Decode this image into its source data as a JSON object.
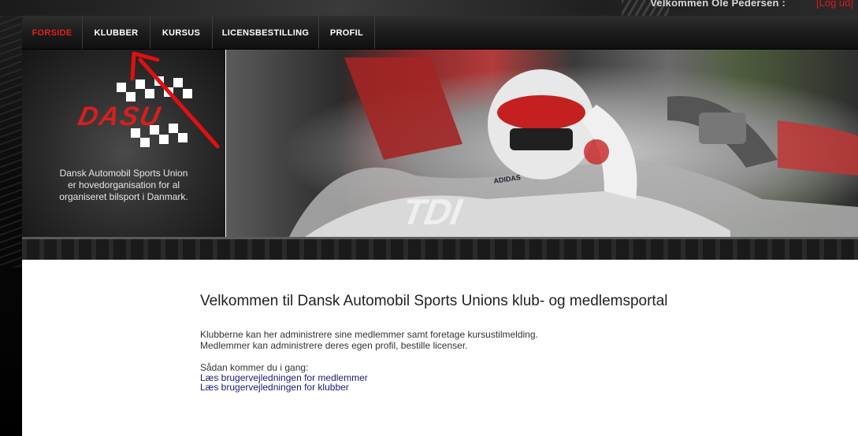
{
  "header": {
    "welcome_text": "Velkommen Ole Pedersen :",
    "logout_label": "[Log ud]"
  },
  "nav": {
    "items": [
      {
        "label": "FORSIDE",
        "active": true
      },
      {
        "label": "KLUBBER",
        "active": false
      },
      {
        "label": "KURSUS",
        "active": false
      },
      {
        "label": "LICENSBESTILLING",
        "active": false
      },
      {
        "label": "PROFIL",
        "active": false
      }
    ]
  },
  "banner": {
    "logo_text": "DASU",
    "description_lines": [
      "Dansk Automobil Sports Union",
      "er hovedorganisation for al",
      "organiseret bilsport i Danmark."
    ],
    "photo_texts": [
      "TDI",
      "ADIDAS"
    ]
  },
  "main": {
    "title": "Velkommen til Dansk Automobil Sports Unions klub- og medlemsportal",
    "intro_lines": [
      "Klubberne kan her administrere sine medlemmer samt foretage kursustilmelding.",
      "Medlemmer kan administrere deres egen profil, bestille licenser."
    ],
    "howto_label": "Sådan kommer du i gang:",
    "links": [
      "Læs brugervejledningen for medlemmer",
      "Læs brugervejledningen for klubber"
    ]
  },
  "colors": {
    "accent_red": "#e02020",
    "link_blue": "#1a1a7a",
    "annotation_arrow": "#e01010"
  },
  "icons": [
    "checkered-flag-icon",
    "annotation-arrow-icon"
  ]
}
